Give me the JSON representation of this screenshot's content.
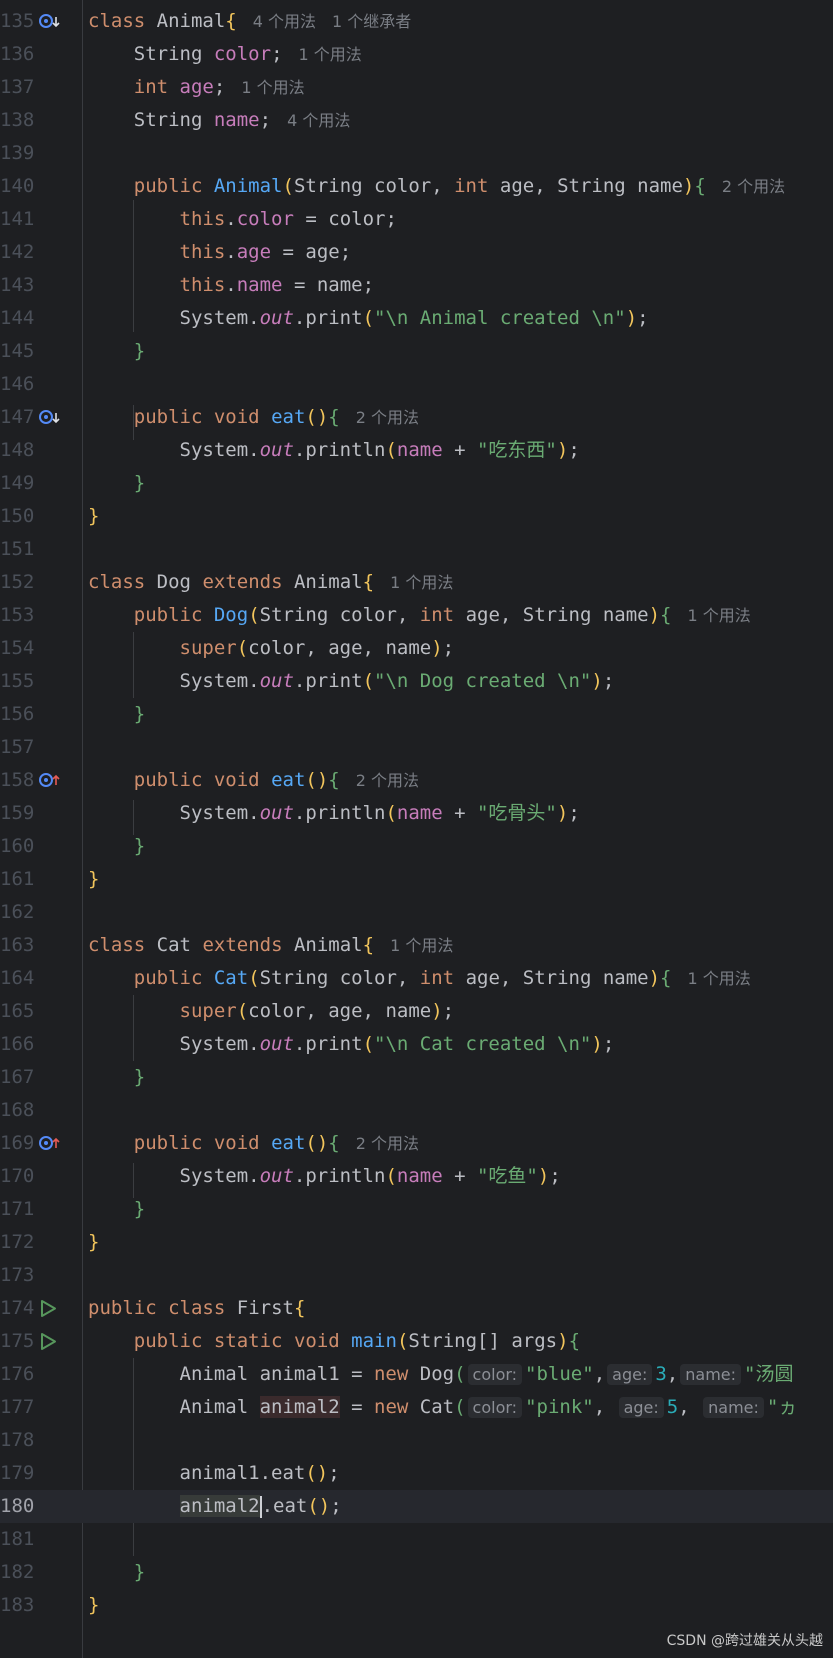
{
  "colors": {
    "background": "#1e1f22",
    "keyword": "#cf8e6d",
    "field": "#c77dbb",
    "method": "#56a8f5",
    "string": "#6aab73",
    "number": "#2aacb8",
    "brace": "#f2c55c",
    "hint": "#7a7e85"
  },
  "icons": {
    "line_135": "implemented-gutter-icon",
    "line_147": "implemented-gutter-icon",
    "line_158": "overrides-gutter-icon",
    "line_169": "overrides-gutter-icon",
    "line_174": "run-gutter-icon",
    "line_175": "run-gutter-icon"
  },
  "lines": {
    "135": {
      "num": "135",
      "c1": "class",
      "c2": "Animal",
      "c3": "{",
      "hint1": "4 个用法",
      "hint2": "1 个继承者"
    },
    "136": {
      "num": "136",
      "c1": "String",
      "c2": "color",
      "c3": ";",
      "hint1": "1 个用法"
    },
    "137": {
      "num": "137",
      "c1": "int",
      "c2": "age",
      "c3": ";",
      "hint1": "1 个用法"
    },
    "138": {
      "num": "138",
      "c1": "String",
      "c2": "name",
      "c3": ";",
      "hint1": "4 个用法"
    },
    "139": {
      "num": "139"
    },
    "140": {
      "num": "140",
      "c1": "public",
      "c2": "Animal",
      "c3": "(",
      "c4": "String color, ",
      "c5": "int",
      "c6": " age, String name",
      "c7": ")",
      "c8": "{",
      "hint1": "2 个用法"
    },
    "141": {
      "num": "141",
      "c1": "this",
      "c2": ".",
      "c3": "color",
      "c4": " = color;"
    },
    "142": {
      "num": "142",
      "c1": "this",
      "c2": ".",
      "c3": "age",
      "c4": " = age;"
    },
    "143": {
      "num": "143",
      "c1": "this",
      "c2": ".",
      "c3": "name",
      "c4": " = name;"
    },
    "144": {
      "num": "144",
      "c1": "System.",
      "c2": "out",
      "c3": ".print",
      "c4": "(",
      "c5": "\"\\n Animal created \\n\"",
      "c6": ")",
      "c7": ";"
    },
    "145": {
      "num": "145",
      "c1": "}"
    },
    "146": {
      "num": "146"
    },
    "147": {
      "num": "147",
      "c1": "public",
      "c2": "void",
      "c3": "eat",
      "c4": "()",
      "c5": "{",
      "hint1": "2 个用法"
    },
    "148": {
      "num": "148",
      "c1": "System.",
      "c2": "out",
      "c3": ".println",
      "c4": "(",
      "c5": "name",
      "c6": " + ",
      "c7": "\"吃东西\"",
      "c8": ")",
      "c9": ";"
    },
    "149": {
      "num": "149",
      "c1": "}"
    },
    "150": {
      "num": "150",
      "c1": "}"
    },
    "151": {
      "num": "151"
    },
    "152": {
      "num": "152",
      "c1": "class",
      "c2": "Dog",
      "c3": "extends",
      "c4": "Animal",
      "c5": "{",
      "hint1": "1 个用法"
    },
    "153": {
      "num": "153",
      "c1": "public",
      "c2": "Dog",
      "c3": "(",
      "c4": "String color, ",
      "c5": "int",
      "c6": " age, String name",
      "c7": ")",
      "c8": "{",
      "hint1": "1 个用法"
    },
    "154": {
      "num": "154",
      "c1": "super",
      "c2": "(",
      "c3": "color, age, name",
      "c4": ")",
      "c5": ";"
    },
    "155": {
      "num": "155",
      "c1": "System.",
      "c2": "out",
      "c3": ".print",
      "c4": "(",
      "c5": "\"\\n Dog created \\n\"",
      "c6": ")",
      "c7": ";"
    },
    "156": {
      "num": "156",
      "c1": "}"
    },
    "157": {
      "num": "157"
    },
    "158": {
      "num": "158",
      "c1": "public",
      "c2": "void",
      "c3": "eat",
      "c4": "()",
      "c5": "{",
      "hint1": "2 个用法"
    },
    "159": {
      "num": "159",
      "c1": "System.",
      "c2": "out",
      "c3": ".println",
      "c4": "(",
      "c5": "name",
      "c6": " + ",
      "c7": "\"吃骨头\"",
      "c8": ")",
      "c9": ";"
    },
    "160": {
      "num": "160",
      "c1": "}"
    },
    "161": {
      "num": "161",
      "c1": "}"
    },
    "162": {
      "num": "162"
    },
    "163": {
      "num": "163",
      "c1": "class",
      "c2": "Cat",
      "c3": "extends",
      "c4": "Animal",
      "c5": "{",
      "hint1": "1 个用法"
    },
    "164": {
      "num": "164",
      "c1": "public",
      "c2": "Cat",
      "c3": "(",
      "c4": "String color, ",
      "c5": "int",
      "c6": " age, String name",
      "c7": ")",
      "c8": "{",
      "hint1": "1 个用法"
    },
    "165": {
      "num": "165",
      "c1": "super",
      "c2": "(",
      "c3": "color, age, name",
      "c4": ")",
      "c5": ";"
    },
    "166": {
      "num": "166",
      "c1": "System.",
      "c2": "out",
      "c3": ".print",
      "c4": "(",
      "c5": "\"\\n Cat created \\n\"",
      "c6": ")",
      "c7": ";"
    },
    "167": {
      "num": "167",
      "c1": "}"
    },
    "168": {
      "num": "168"
    },
    "169": {
      "num": "169",
      "c1": "public",
      "c2": "void",
      "c3": "eat",
      "c4": "()",
      "c5": "{",
      "hint1": "2 个用法"
    },
    "170": {
      "num": "170",
      "c1": "System.",
      "c2": "out",
      "c3": ".println",
      "c4": "(",
      "c5": "name",
      "c6": " + ",
      "c7": "\"吃鱼\"",
      "c8": ")",
      "c9": ";"
    },
    "171": {
      "num": "171",
      "c1": "}"
    },
    "172": {
      "num": "172",
      "c1": "}"
    },
    "173": {
      "num": "173"
    },
    "174": {
      "num": "174",
      "c1": "public",
      "c2": "class",
      "c3": "First",
      "c4": "{"
    },
    "175": {
      "num": "175",
      "c1": "public",
      "c2": "static",
      "c3": "void",
      "c4": "main",
      "c5": "(",
      "c6": "String[] args",
      "c7": ")",
      "c8": "{"
    },
    "176": {
      "num": "176",
      "c1": "Animal animal1 = ",
      "c2": "new",
      "c3": " Dog",
      "c4": "(",
      "p1": "color:",
      "s1": "\"blue\"",
      "c5": ",",
      "p2": "age:",
      "n1": "3",
      "c6": ",",
      "p3": "name:",
      "s2": "\"汤圆"
    },
    "177": {
      "num": "177",
      "c1": "Animal ",
      "c2": "animal2",
      "c3": " = ",
      "c4": "new",
      "c5": " Cat",
      "c6": "(",
      "p1": "color:",
      "s1": "\"pink\"",
      "c7": ", ",
      "p2": "age:",
      "n1": "5",
      "c8": ", ",
      "p3": "name:",
      "s2": "\"ヵ"
    },
    "178": {
      "num": "178"
    },
    "179": {
      "num": "179",
      "c1": "animal1.eat",
      "c2": "()",
      "c3": ";"
    },
    "180": {
      "num": "180",
      "c1": "animal2",
      "c2": ".eat",
      "c3": "()",
      "c4": ";"
    },
    "181": {
      "num": "181"
    },
    "182": {
      "num": "182",
      "c1": "}"
    },
    "183": {
      "num": "183",
      "c1": "}"
    }
  },
  "watermark": "CSDN @跨过雄关从头越"
}
